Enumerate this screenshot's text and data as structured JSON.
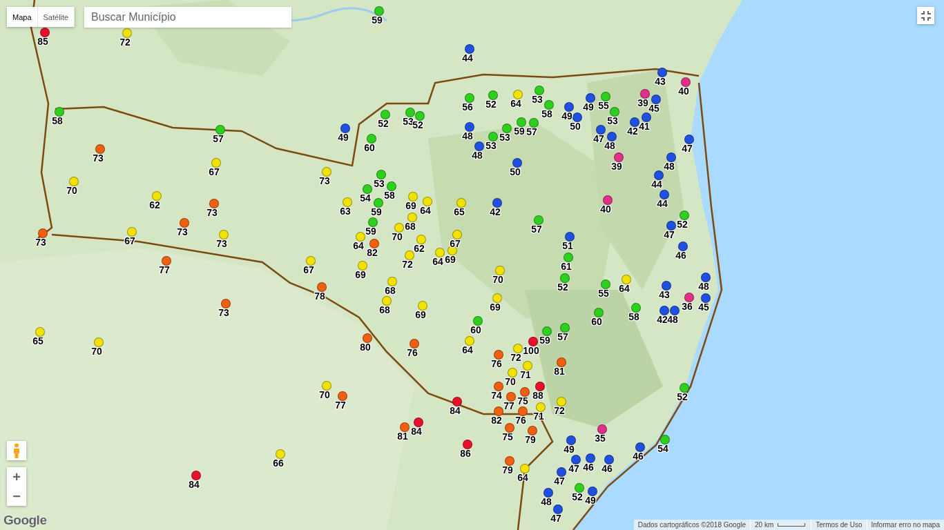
{
  "map_type_tabs": [
    {
      "label": "Mapa",
      "selected": true
    },
    {
      "label": "Satélite",
      "selected": false
    }
  ],
  "search": {
    "placeholder": "Buscar Município"
  },
  "markers": [
    {
      "value": "85",
      "color": "#e8102a"
    },
    {
      "value": "72",
      "color": "#f2e200"
    },
    {
      "value": "59",
      "color": "#2ed020"
    },
    {
      "value": "44",
      "color": "#2050e0"
    },
    {
      "value": "58",
      "color": "#2ed020"
    },
    {
      "value": "57",
      "color": "#2ed020"
    },
    {
      "value": "73",
      "color": "#f06010"
    },
    {
      "value": "67",
      "color": "#f2e200"
    },
    {
      "value": "70",
      "color": "#f2e200"
    },
    {
      "value": "62",
      "color": "#f2e200"
    },
    {
      "value": "73",
      "color": "#f06010"
    },
    {
      "value": "73",
      "color": "#f06010"
    },
    {
      "value": "73",
      "color": "#f06010"
    },
    {
      "value": "73",
      "color": "#f2e200"
    },
    {
      "value": "67",
      "color": "#f2e200"
    },
    {
      "value": "77",
      "color": "#f06010"
    },
    {
      "value": "73",
      "color": "#f06010"
    },
    {
      "value": "65",
      "color": "#f2e200"
    },
    {
      "value": "70",
      "color": "#f2e200"
    },
    {
      "value": "49",
      "color": "#2050e0"
    },
    {
      "value": "60",
      "color": "#2ed020"
    },
    {
      "value": "52",
      "color": "#2ed020"
    },
    {
      "value": "53",
      "color": "#2ed020"
    },
    {
      "value": "52",
      "color": "#2ed020"
    },
    {
      "value": "73",
      "color": "#f2e200"
    },
    {
      "value": "53",
      "color": "#2ed020"
    },
    {
      "value": "54",
      "color": "#2ed020"
    },
    {
      "value": "58",
      "color": "#2ed020"
    },
    {
      "value": "63",
      "color": "#f2e200"
    },
    {
      "value": "59",
      "color": "#2ed020"
    },
    {
      "value": "59",
      "color": "#2ed020"
    },
    {
      "value": "69",
      "color": "#f2e200"
    },
    {
      "value": "64",
      "color": "#f2e200"
    },
    {
      "value": "65",
      "color": "#f2e200"
    },
    {
      "value": "42",
      "color": "#2050e0"
    },
    {
      "value": "68",
      "color": "#f2e200"
    },
    {
      "value": "70",
      "color": "#f2e200"
    },
    {
      "value": "64",
      "color": "#f2e200"
    },
    {
      "value": "82",
      "color": "#f06010"
    },
    {
      "value": "62",
      "color": "#f2e200"
    },
    {
      "value": "67",
      "color": "#f2e200"
    },
    {
      "value": "64",
      "color": "#f2e200"
    },
    {
      "value": "69",
      "color": "#f2e200"
    },
    {
      "value": "72",
      "color": "#f2e200"
    },
    {
      "value": "67",
      "color": "#f2e200"
    },
    {
      "value": "69",
      "color": "#f2e200"
    },
    {
      "value": "68",
      "color": "#f2e200"
    },
    {
      "value": "78",
      "color": "#f06010"
    },
    {
      "value": "68",
      "color": "#f2e200"
    },
    {
      "value": "69",
      "color": "#f2e200"
    },
    {
      "value": "70",
      "color": "#f2e200"
    },
    {
      "value": "69",
      "color": "#f2e200"
    },
    {
      "value": "56",
      "color": "#2ed020"
    },
    {
      "value": "52",
      "color": "#2ed020"
    },
    {
      "value": "64",
      "color": "#f2e200"
    },
    {
      "value": "53",
      "color": "#2ed020"
    },
    {
      "value": "58",
      "color": "#2ed020"
    },
    {
      "value": "48",
      "color": "#2050e0"
    },
    {
      "value": "48",
      "color": "#2050e0"
    },
    {
      "value": "53",
      "color": "#2ed020"
    },
    {
      "value": "53",
      "color": "#2ed020"
    },
    {
      "value": "59",
      "color": "#2ed020"
    },
    {
      "value": "57",
      "color": "#2ed020"
    },
    {
      "value": "50",
      "color": "#2050e0"
    },
    {
      "value": "57",
      "color": "#2ed020"
    },
    {
      "value": "51",
      "color": "#2050e0"
    },
    {
      "value": "61",
      "color": "#2ed020"
    },
    {
      "value": "52",
      "color": "#2ed020"
    },
    {
      "value": "55",
      "color": "#2ed020"
    },
    {
      "value": "64",
      "color": "#f2e200"
    },
    {
      "value": "60",
      "color": "#2ed020"
    },
    {
      "value": "58",
      "color": "#2ed020"
    },
    {
      "value": "49",
      "color": "#2050e0"
    },
    {
      "value": "50",
      "color": "#2050e0"
    },
    {
      "value": "49",
      "color": "#2050e0"
    },
    {
      "value": "55",
      "color": "#2ed020"
    },
    {
      "value": "53",
      "color": "#2ed020"
    },
    {
      "value": "47",
      "color": "#2050e0"
    },
    {
      "value": "48",
      "color": "#2050e0"
    },
    {
      "value": "39",
      "color": "#e0308a"
    },
    {
      "value": "42",
      "color": "#2050e0"
    },
    {
      "value": "41",
      "color": "#2050e0"
    },
    {
      "value": "43",
      "color": "#2050e0"
    },
    {
      "value": "40",
      "color": "#e0308a"
    },
    {
      "value": "39",
      "color": "#e0308a"
    },
    {
      "value": "45",
      "color": "#2050e0"
    },
    {
      "value": "47",
      "color": "#2050e0"
    },
    {
      "value": "48",
      "color": "#2050e0"
    },
    {
      "value": "44",
      "color": "#2050e0"
    },
    {
      "value": "44",
      "color": "#2050e0"
    },
    {
      "value": "40",
      "color": "#e0308a"
    },
    {
      "value": "52",
      "color": "#2ed020"
    },
    {
      "value": "47",
      "color": "#2050e0"
    },
    {
      "value": "46",
      "color": "#2050e0"
    },
    {
      "value": "43",
      "color": "#2050e0"
    },
    {
      "value": "48",
      "color": "#2050e0"
    },
    {
      "value": "36",
      "color": "#e0308a"
    },
    {
      "value": "45",
      "color": "#2050e0"
    },
    {
      "value": "42",
      "color": "#2050e0"
    },
    {
      "value": "48",
      "color": "#2050e0"
    },
    {
      "value": "57",
      "color": "#2ed020"
    },
    {
      "value": "59",
      "color": "#2ed020"
    },
    {
      "value": "100",
      "color": "#e8102a"
    },
    {
      "value": "72",
      "color": "#f2e200"
    },
    {
      "value": "76",
      "color": "#f06010"
    },
    {
      "value": "71",
      "color": "#f2e200"
    },
    {
      "value": "81",
      "color": "#f06010"
    },
    {
      "value": "70",
      "color": "#f2e200"
    },
    {
      "value": "74",
      "color": "#f06010"
    },
    {
      "value": "77",
      "color": "#f06010"
    },
    {
      "value": "75",
      "color": "#f06010"
    },
    {
      "value": "88",
      "color": "#e8102a"
    },
    {
      "value": "82",
      "color": "#f06010"
    },
    {
      "value": "76",
      "color": "#f06010"
    },
    {
      "value": "71",
      "color": "#f2e200"
    },
    {
      "value": "79",
      "color": "#f06010"
    },
    {
      "value": "75",
      "color": "#f06010"
    },
    {
      "value": "72",
      "color": "#f2e200"
    },
    {
      "value": "84",
      "color": "#e8102a"
    },
    {
      "value": "60",
      "color": "#2ed020"
    },
    {
      "value": "64",
      "color": "#f2e200"
    },
    {
      "value": "76",
      "color": "#f06010"
    },
    {
      "value": "80",
      "color": "#f06010"
    },
    {
      "value": "70",
      "color": "#f2e200"
    },
    {
      "value": "77",
      "color": "#f06010"
    },
    {
      "value": "81",
      "color": "#f06010"
    },
    {
      "value": "84",
      "color": "#e8102a"
    },
    {
      "value": "86",
      "color": "#e8102a"
    },
    {
      "value": "35",
      "color": "#e0308a"
    },
    {
      "value": "49",
      "color": "#2050e0"
    },
    {
      "value": "47",
      "color": "#2050e0"
    },
    {
      "value": "46",
      "color": "#2050e0"
    },
    {
      "value": "46",
      "color": "#2050e0"
    },
    {
      "value": "46",
      "color": "#2050e0"
    },
    {
      "value": "54",
      "color": "#2ed020"
    },
    {
      "value": "52",
      "color": "#2ed020"
    },
    {
      "value": "79",
      "color": "#f06010"
    },
    {
      "value": "64",
      "color": "#f2e200"
    },
    {
      "value": "47",
      "color": "#2050e0"
    },
    {
      "value": "52",
      "color": "#2ed020"
    },
    {
      "value": "48",
      "color": "#2050e0"
    },
    {
      "value": "49",
      "color": "#2050e0"
    },
    {
      "value": "47",
      "color": "#2050e0"
    },
    {
      "value": "66",
      "color": "#f2e200"
    },
    {
      "value": "84",
      "color": "#e8102a"
    }
  ],
  "zoom_controls": {
    "zoom_in": "+",
    "zoom_out": "−"
  },
  "logo": "Google",
  "attribution": {
    "map_data": "Dados cartográficos ©2018 Google",
    "scale": "20 km",
    "terms": "Termos de Uso",
    "report": "Informar erro no mapa"
  }
}
